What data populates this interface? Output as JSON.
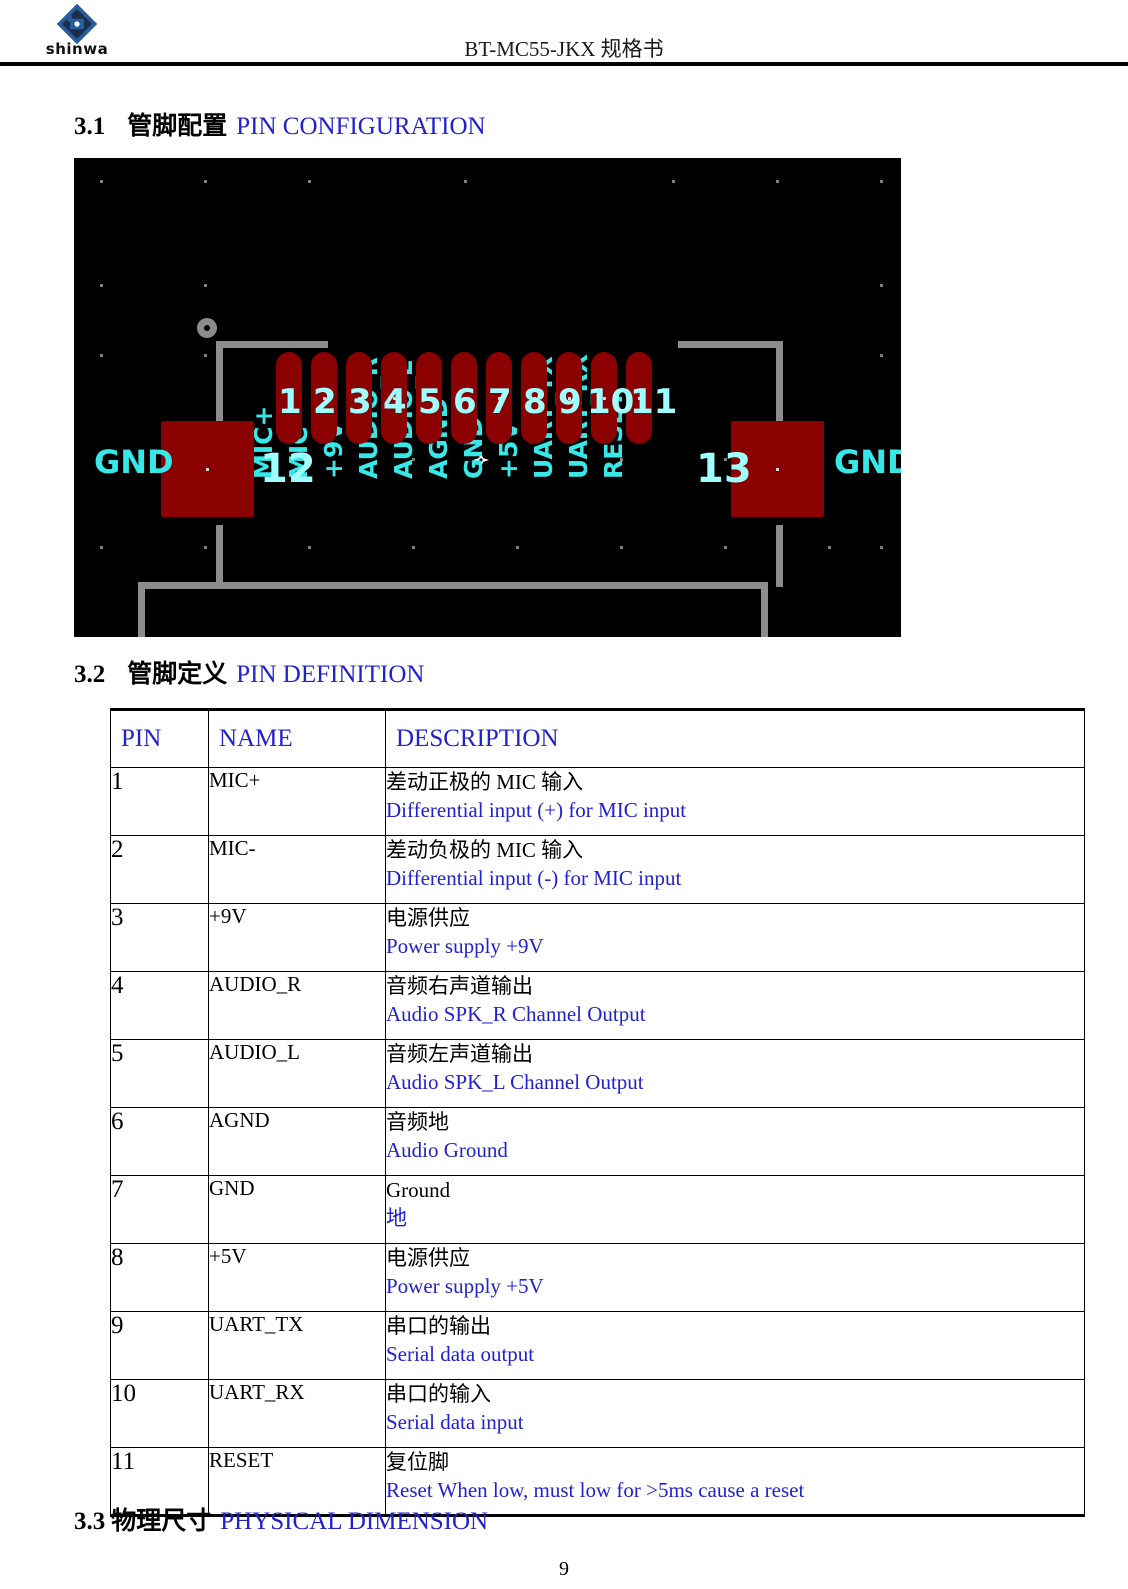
{
  "header": {
    "logo_word": "shinwa",
    "logo_icon": "shinwa-diamond-logo",
    "title": "BT-MC55-JKX 规格书"
  },
  "sections": {
    "s31": {
      "num": "3.1",
      "cn": "管脚配置",
      "en": "PIN CONFIGURATION"
    },
    "s32": {
      "num": "3.2",
      "cn": "管脚定义",
      "en": "PIN DEFINITION"
    },
    "s33": {
      "num": "3.3",
      "cn": "物理尺寸",
      "en": "PHYSICAL DIMENSION"
    }
  },
  "pcb_figure": {
    "background_color": "#000000",
    "pad_color": "#8b0000",
    "silkscreen_color": "#38e8e8",
    "trace_color": "#8c8c8c",
    "pin_labels": [
      "MIC+",
      "MIC-",
      "+9V",
      "AUDIO_R",
      "AUDIO_L",
      "AGND",
      "GND",
      "+5V",
      "UART_TX",
      "UART_RX",
      "RESET"
    ],
    "pin_numbers": [
      "1",
      "2",
      "3",
      "4",
      "5",
      "6",
      "7",
      "8",
      "9",
      "10",
      "11"
    ],
    "left_gnd_label": "GND",
    "right_gnd_label": "GND",
    "left_pad_number": "12",
    "right_pad_number": "13"
  },
  "table": {
    "headers": [
      "PIN",
      "NAME",
      "DESCRIPTION"
    ],
    "rows": [
      {
        "pin": "1",
        "name": "MIC+",
        "line1": "差动正极的 MIC 输入",
        "line2": "Differential input (+) for MIC input",
        "line1_color": "black",
        "line2_color": "blue"
      },
      {
        "pin": "2",
        "name": "MIC-",
        "line1": "差动负极的 MIC 输入",
        "line2": "Differential input (-) for MIC input",
        "line1_color": "black",
        "line2_color": "blue"
      },
      {
        "pin": "3",
        "name": "+9V",
        "line1": "电源供应",
        "line2": "Power supply +9V",
        "line1_color": "black",
        "line2_color": "blue"
      },
      {
        "pin": "4",
        "name": "AUDIO_R",
        "line1": "音频右声道输出",
        "line2": "Audio SPK_R Channel Output",
        "line1_color": "black",
        "line2_color": "blue"
      },
      {
        "pin": "5",
        "name": "AUDIO_L",
        "line1": "音频左声道输出",
        "line2": "Audio SPK_L Channel Output",
        "line1_color": "black",
        "line2_color": "blue"
      },
      {
        "pin": "6",
        "name": "AGND",
        "line1": "音频地",
        "line2": "Audio Ground",
        "line1_color": "black",
        "line2_color": "blue"
      },
      {
        "pin": "7",
        "name": "GND",
        "line1": "Ground",
        "line2": "地",
        "line1_color": "black",
        "line2_color": "blue"
      },
      {
        "pin": "8",
        "name": "+5V",
        "line1": "电源供应",
        "line2": "Power supply +5V",
        "line1_color": "black",
        "line2_color": "blue"
      },
      {
        "pin": "9",
        "name": "UART_TX",
        "line1": "串口的输出",
        "line2": "Serial data output",
        "line1_color": "black",
        "line2_color": "blue"
      },
      {
        "pin": "10",
        "name": "UART_RX",
        "line1": "串口的输入",
        "line2": "Serial data input",
        "line1_color": "black",
        "line2_color": "blue"
      },
      {
        "pin": "11",
        "name": "RESET",
        "line1": "复位脚",
        "line2": "Reset When low, must low for >5ms cause a reset",
        "line1_color": "black",
        "line2_color": "blue"
      }
    ]
  },
  "footer": {
    "page_number": "9"
  }
}
